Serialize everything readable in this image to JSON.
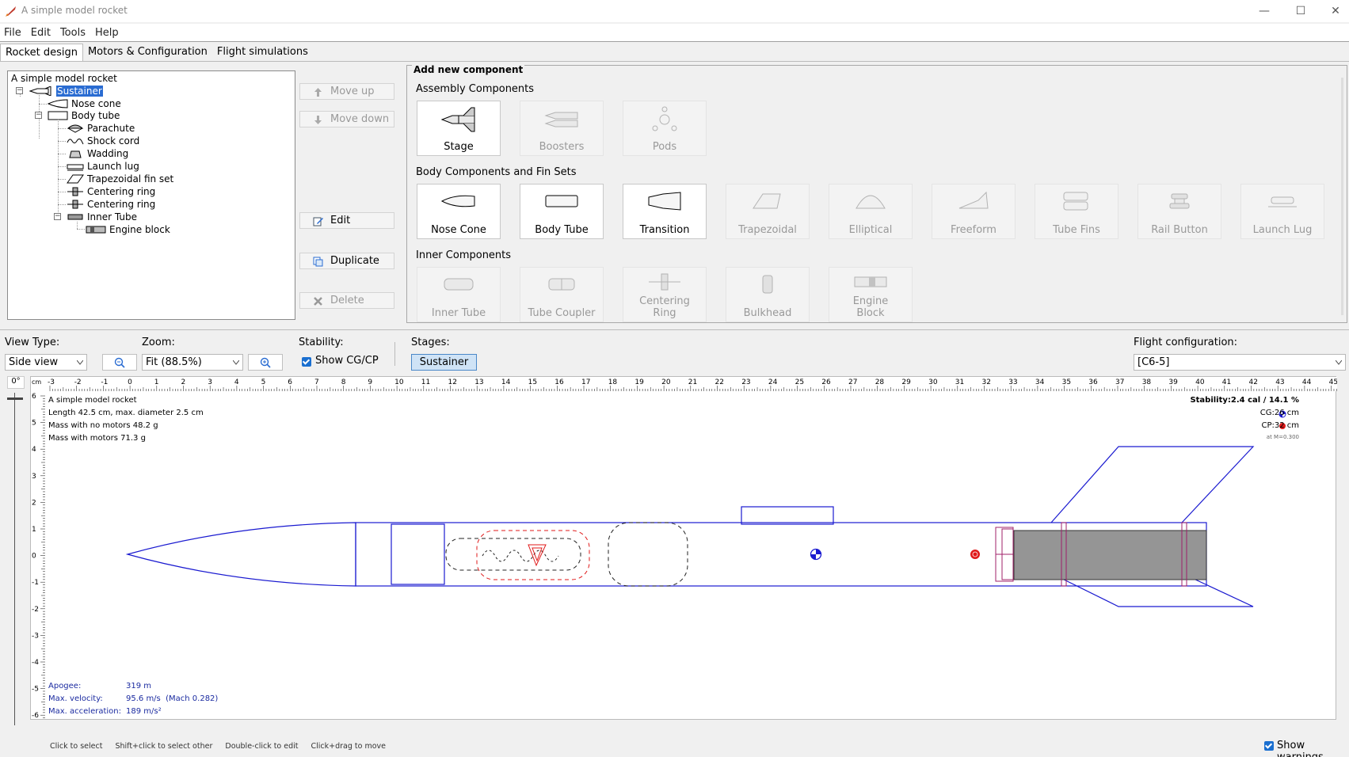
{
  "window": {
    "title": "A simple model rocket"
  },
  "menu": [
    "File",
    "Edit",
    "Tools",
    "Help"
  ],
  "tabs": [
    "Rocket design",
    "Motors & Configuration",
    "Flight simulations"
  ],
  "tree": {
    "root": "A simple model rocket",
    "items": [
      {
        "label": "Sustainer",
        "selected": true
      },
      {
        "label": "Nose cone"
      },
      {
        "label": "Body tube"
      },
      {
        "label": "Parachute"
      },
      {
        "label": "Shock cord"
      },
      {
        "label": "Wadding"
      },
      {
        "label": "Launch lug"
      },
      {
        "label": "Trapezoidal fin set"
      },
      {
        "label": "Centering ring"
      },
      {
        "label": "Centering ring"
      },
      {
        "label": "Inner Tube"
      },
      {
        "label": "Engine block"
      }
    ]
  },
  "side_buttons": {
    "move_up": "Move up",
    "move_down": "Move down",
    "edit": "Edit",
    "duplicate": "Duplicate",
    "delete": "Delete"
  },
  "add_panel": {
    "title": "Add new component",
    "assembly_title": "Assembly Components",
    "assembly": [
      "Stage",
      "Boosters",
      "Pods"
    ],
    "body_title": "Body Components and Fin Sets",
    "body": [
      "Nose Cone",
      "Body Tube",
      "Transition",
      "Trapezoidal",
      "Elliptical",
      "Freeform",
      "Tube Fins",
      "Rail Button",
      "Launch Lug"
    ],
    "inner_title": "Inner Components",
    "inner": [
      "Inner Tube",
      "Tube Coupler",
      "Centering\nRing",
      "Bulkhead",
      "Engine\nBlock"
    ]
  },
  "controls": {
    "view_type_label": "View Type:",
    "view_type_value": "Side view",
    "zoom_label": "Zoom:",
    "zoom_value": "Fit (88.5%)",
    "stability_label": "Stability:",
    "show_cgcp": "Show CG/CP",
    "stages_label": "Stages:",
    "stage": "Sustainer",
    "flight_config_label": "Flight configuration:",
    "flight_config_value": "[C6-5]",
    "rotation": "0°"
  },
  "figure": {
    "ruler_unit": "cm",
    "h_ticks": [
      "-3",
      "-2",
      "-1",
      "0",
      "1",
      "2",
      "3",
      "4",
      "5",
      "6",
      "7",
      "8",
      "9",
      "10",
      "11",
      "12",
      "13",
      "14",
      "15",
      "16",
      "17",
      "18",
      "19",
      "20",
      "21",
      "22",
      "23",
      "24",
      "25",
      "26",
      "27",
      "28",
      "29",
      "30",
      "31",
      "32",
      "33",
      "34",
      "35",
      "36",
      "37",
      "38",
      "39",
      "40",
      "41",
      "42",
      "43",
      "44",
      "45"
    ],
    "v_ticks": [
      "6",
      "5",
      "4",
      "3",
      "2",
      "1",
      "0",
      "-1",
      "-2",
      "-3",
      "-4",
      "-5",
      "-6"
    ],
    "info": {
      "name": "A simple model rocket",
      "length": "Length 42.5 cm, max. diameter 2.5 cm",
      "mass_no_motors": "Mass with no motors 48.2 g",
      "mass_with_motors": "Mass with motors 71.3 g"
    },
    "stability": "Stability:2.4 cal / 14.1 %",
    "cg": "CG:26 cm",
    "cp": "CP:32 cm",
    "mach": "at M=0.300",
    "flight": {
      "apogee_label": "Apogee:",
      "apogee": "319 m",
      "vel_label": "Max. velocity:",
      "vel": "95.6 m/s  (Mach 0.282)",
      "acc_label": "Max. acceleration:",
      "acc": "189 m/s²"
    }
  },
  "status": {
    "hints": [
      "Click to select",
      "Shift+click to select other",
      "Double-click to edit",
      "Click+drag to move"
    ],
    "show_warnings": "Show warnings"
  }
}
